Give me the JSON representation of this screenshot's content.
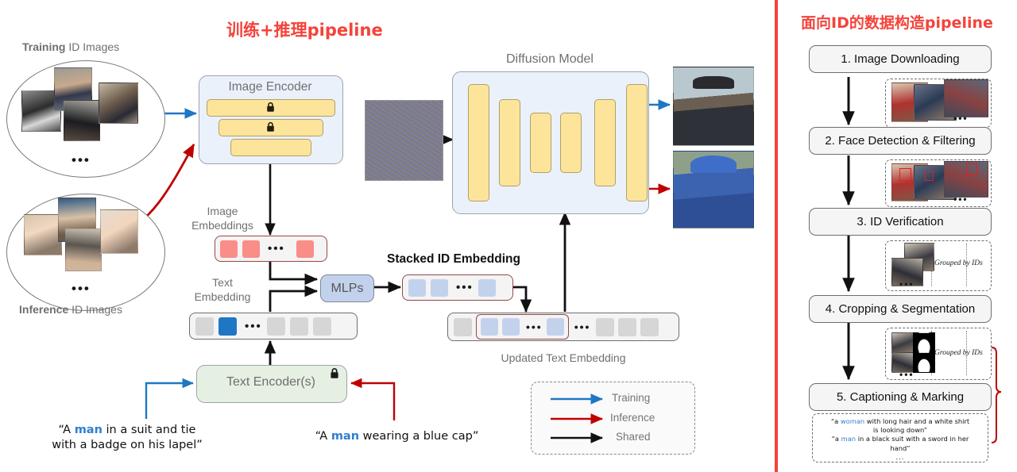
{
  "left_panel": {
    "title": "训练+推理pipeline",
    "title_color": "#f4433a",
    "training_images_label_bold": "Training",
    "training_images_label_rest": " ID Images",
    "inference_images_label_bold": "Inference",
    "inference_images_label_rest": " ID Images",
    "image_encoder": "Image Encoder",
    "image_embeddings_line1": "Image",
    "image_embeddings_line2": "Embeddings",
    "text_embedding_line1": "Text",
    "text_embedding_line2": "Embedding",
    "mlps": "MLPs",
    "stacked_id_embedding": "Stacked ID Embedding",
    "updated_text_embedding": "Updated Text Embedding",
    "diffusion_model": "Diffusion Model",
    "text_encoder": "Text Encoder(s)",
    "prompt_training": {
      "pre": "“A ",
      "kw": "man",
      "post": " in a suit and tie",
      "line2": "with a badge on his lapel”"
    },
    "prompt_inference": {
      "pre": "“A ",
      "kw": "man",
      "post": " wearing a blue cap”"
    },
    "ellipsis": "•••",
    "lock_icon": "lock-icon"
  },
  "legend": {
    "items": [
      {
        "label": "Training",
        "color": "#1f77c4"
      },
      {
        "label": "Inference",
        "color": "#c00000"
      },
      {
        "label": "Shared",
        "color": "#111111"
      }
    ]
  },
  "right_panel": {
    "title": "面向ID的数据构造pipeline",
    "title_color": "#f4433a",
    "steps": [
      {
        "label": "1. Image Downloading"
      },
      {
        "label": "2. Face Detection & Filtering"
      },
      {
        "label": "3. ID Verification"
      },
      {
        "label": "4. Cropping & Segmentation"
      },
      {
        "label": "5. Captioning & Marking"
      }
    ],
    "grouped_by_ids": "Grouped by IDs",
    "ellipsis": "•••",
    "captions": {
      "line1_pre": "“a ",
      "line1_kw": "woman",
      "line1_post": " with long hair and a white shirt",
      "line2": "is looking down”",
      "line3_pre": "“a ",
      "line3_kw": "man",
      "line3_post": " in a black suit with a sword in her",
      "line4": "hand”",
      "line5": "..."
    }
  },
  "embeddings": {
    "image_cells": [
      "red",
      "red",
      "dots",
      "red"
    ],
    "text_cells": [
      "gray",
      "bluedark",
      "dots",
      "gray",
      "gray",
      "gray"
    ],
    "stacked_cells": [
      "blue",
      "blue",
      "dots",
      "blue"
    ],
    "updated_cells": [
      "gray",
      "GROUP",
      "dots",
      "gray",
      "gray",
      "gray"
    ],
    "updated_group_cells": [
      "blue",
      "blue",
      "dots",
      "blue"
    ]
  }
}
